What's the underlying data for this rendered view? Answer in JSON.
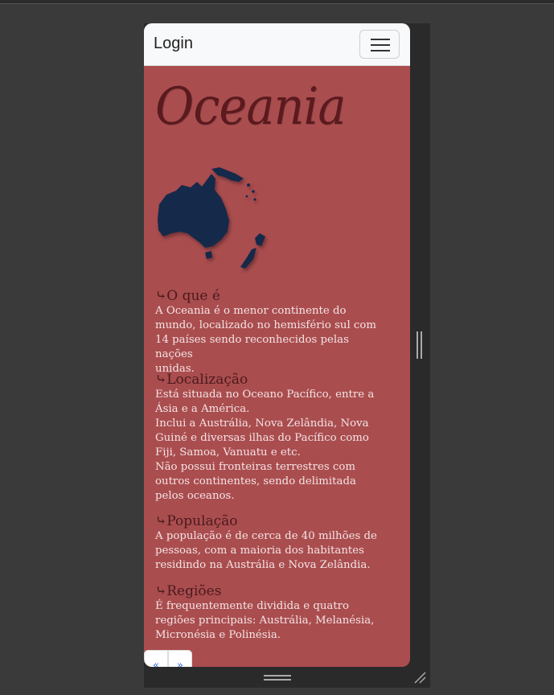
{
  "navbar": {
    "brand": "Login",
    "toggler_icon": "hamburger-menu-icon"
  },
  "page": {
    "title": "Oceania",
    "map_icon": "oceania-map-icon",
    "section_marker": "⤷",
    "sections": [
      {
        "heading": "O que é",
        "lines": [
          "  A Oceania é o menor continente do",
          "mundo, localizado no    hemisfério sul com",
          "14 países sendo reconhecidos pelas nações",
          "unidas."
        ]
      },
      {
        "heading": "Localização",
        "lines": [
          "  Está situada no Oceano Pacífico, entre a",
          "Ásia e a América.",
          "Inclui a Austrália, Nova Zelândia, Nova",
          "Guiné e diversas ilhas do Pacífico como",
          "Fiji, Samoa, Vanuatu e etc.",
          "Não possui fronteiras terrestres com",
          "outros continentes, sendo delimitada",
          "pelos oceanos."
        ]
      },
      {
        "heading": "População",
        "lines": [
          "  A população é de cerca de 40 milhões de",
          "pessoas, com a maioria dos habitantes",
          "residindo na Austrália e Nova Zelândia."
        ]
      },
      {
        "heading": "Regiões",
        "lines": [
          "  É frequentemente dividida e quatro",
          "regiões principais: Austrália, Melanésia,",
          "Micronésia e Polinésia."
        ]
      }
    ]
  },
  "pagination": {
    "prev_label": "«",
    "next_label": "»"
  },
  "colors": {
    "page_background": "#aa4d4f",
    "title_color": "#5a1a1e",
    "map_color": "#15294a"
  }
}
